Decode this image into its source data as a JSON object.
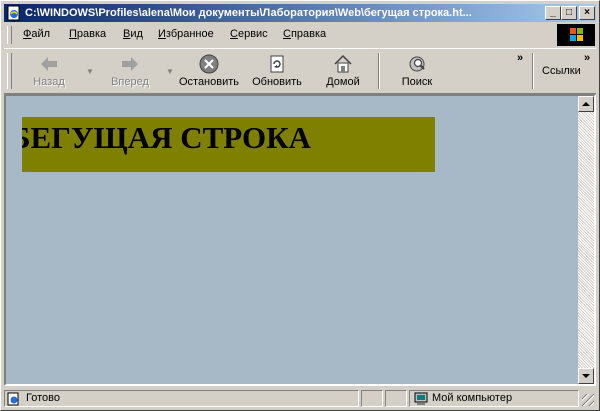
{
  "window": {
    "title": "C:\\WINDOWS\\Profiles\\alena\\Мои документы\\Лаборатория\\Web\\бегущая строка.ht...",
    "minimize": "_",
    "maximize": "□",
    "close": "×"
  },
  "menu": {
    "items": [
      {
        "accel": "Ф",
        "rest": "айл"
      },
      {
        "accel": "П",
        "rest": "равка"
      },
      {
        "accel": "В",
        "rest": "ид"
      },
      {
        "accel": "И",
        "rest": "збранное"
      },
      {
        "accel": "С",
        "rest": "ервис"
      },
      {
        "accel": "С",
        "rest": "правка"
      }
    ]
  },
  "toolbar": {
    "back": "Назад",
    "forward": "Вперед",
    "stop": "Остановить",
    "refresh": "Обновить",
    "home": "Домой",
    "search": "Поиск",
    "more": "»",
    "links_more": "»",
    "links": "Ссылки"
  },
  "page": {
    "marquee_text": "БЕГУЩАЯ СТРОКА",
    "marquee_bg": "#808000",
    "background": "#a7b8c6"
  },
  "status": {
    "text": "Готово",
    "zone": "Мой компьютер"
  }
}
